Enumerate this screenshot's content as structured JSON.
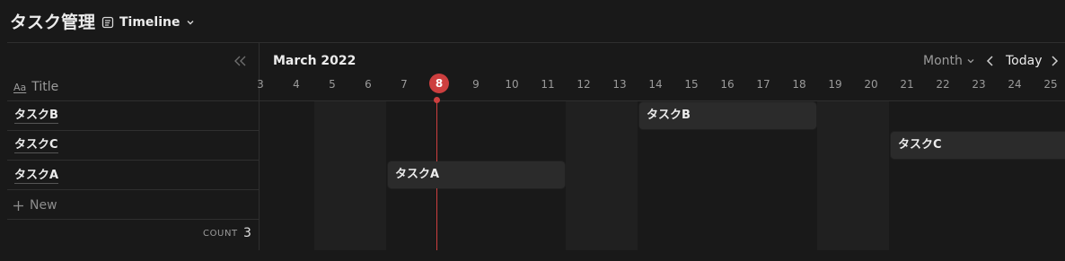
{
  "header": {
    "title": "タスク管理",
    "view_label": "Timeline",
    "view_icon": "document-list-icon"
  },
  "table": {
    "title_header": "Title",
    "title_type_glyph": "Aa",
    "rows": [
      {
        "title": "タスクB"
      },
      {
        "title": "タスクC"
      },
      {
        "title": "タスクA"
      }
    ],
    "new_label": "New",
    "count_label": "COUNT",
    "count_value": "3"
  },
  "timeline": {
    "month_label": "March 2022",
    "scale_label": "Month",
    "today_label": "Today",
    "days": [
      "3",
      "4",
      "5",
      "6",
      "7",
      "8",
      "9",
      "10",
      "11",
      "12",
      "13",
      "14",
      "15",
      "16",
      "17",
      "18",
      "19",
      "20",
      "21",
      "22",
      "23",
      "24",
      "25"
    ],
    "today_day": "8",
    "bars": [
      {
        "label": "タスクB"
      },
      {
        "label": "タスクC"
      },
      {
        "label": "タスクA"
      }
    ]
  },
  "colors": {
    "background": "#191919",
    "today_accent": "#cd3f3f",
    "weekend_shade": "#202020",
    "bar_fill": "#2b2b2b"
  }
}
